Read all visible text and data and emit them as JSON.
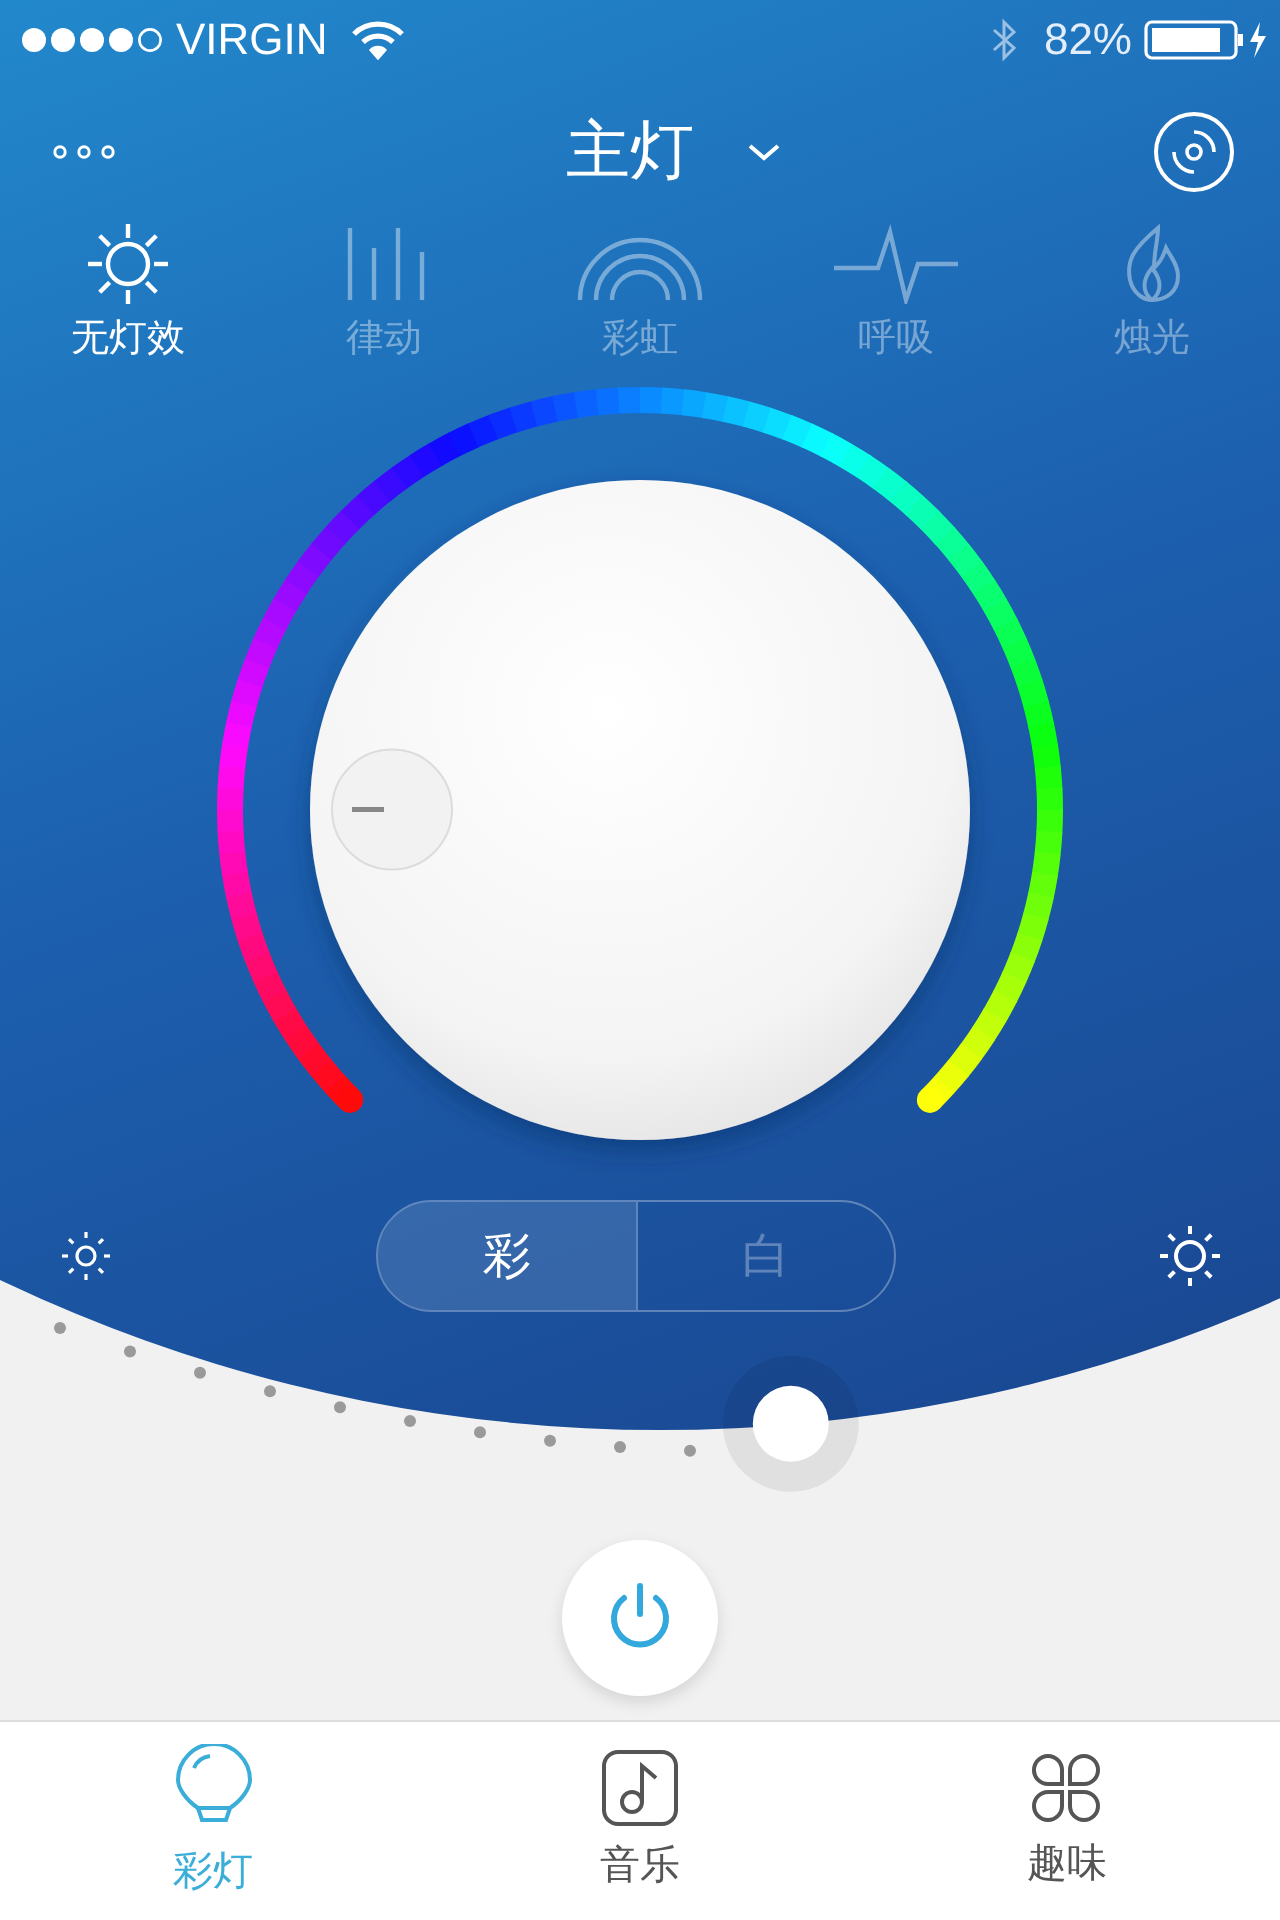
{
  "status_bar": {
    "carrier": "VIRGIN",
    "battery": "82%"
  },
  "header": {
    "title": "主灯"
  },
  "effects": [
    {
      "label": "无灯效",
      "selected": true,
      "kind": "sun"
    },
    {
      "label": "律动",
      "selected": false,
      "kind": "bars"
    },
    {
      "label": "彩虹",
      "selected": false,
      "kind": "rainbow"
    },
    {
      "label": "呼吸",
      "selected": false,
      "kind": "pulse"
    },
    {
      "label": "烛光",
      "selected": false,
      "kind": "flame"
    }
  ],
  "mode_toggle": [
    {
      "label": "彩",
      "selected": true
    },
    {
      "label": "白",
      "selected": false
    }
  ],
  "brightness": {
    "level": 0.63
  },
  "tabs": [
    {
      "label": "彩灯",
      "selected": true,
      "kind": "bulb"
    },
    {
      "label": "音乐",
      "selected": false,
      "kind": "music"
    },
    {
      "label": "趣味",
      "selected": false,
      "kind": "clover"
    }
  ]
}
